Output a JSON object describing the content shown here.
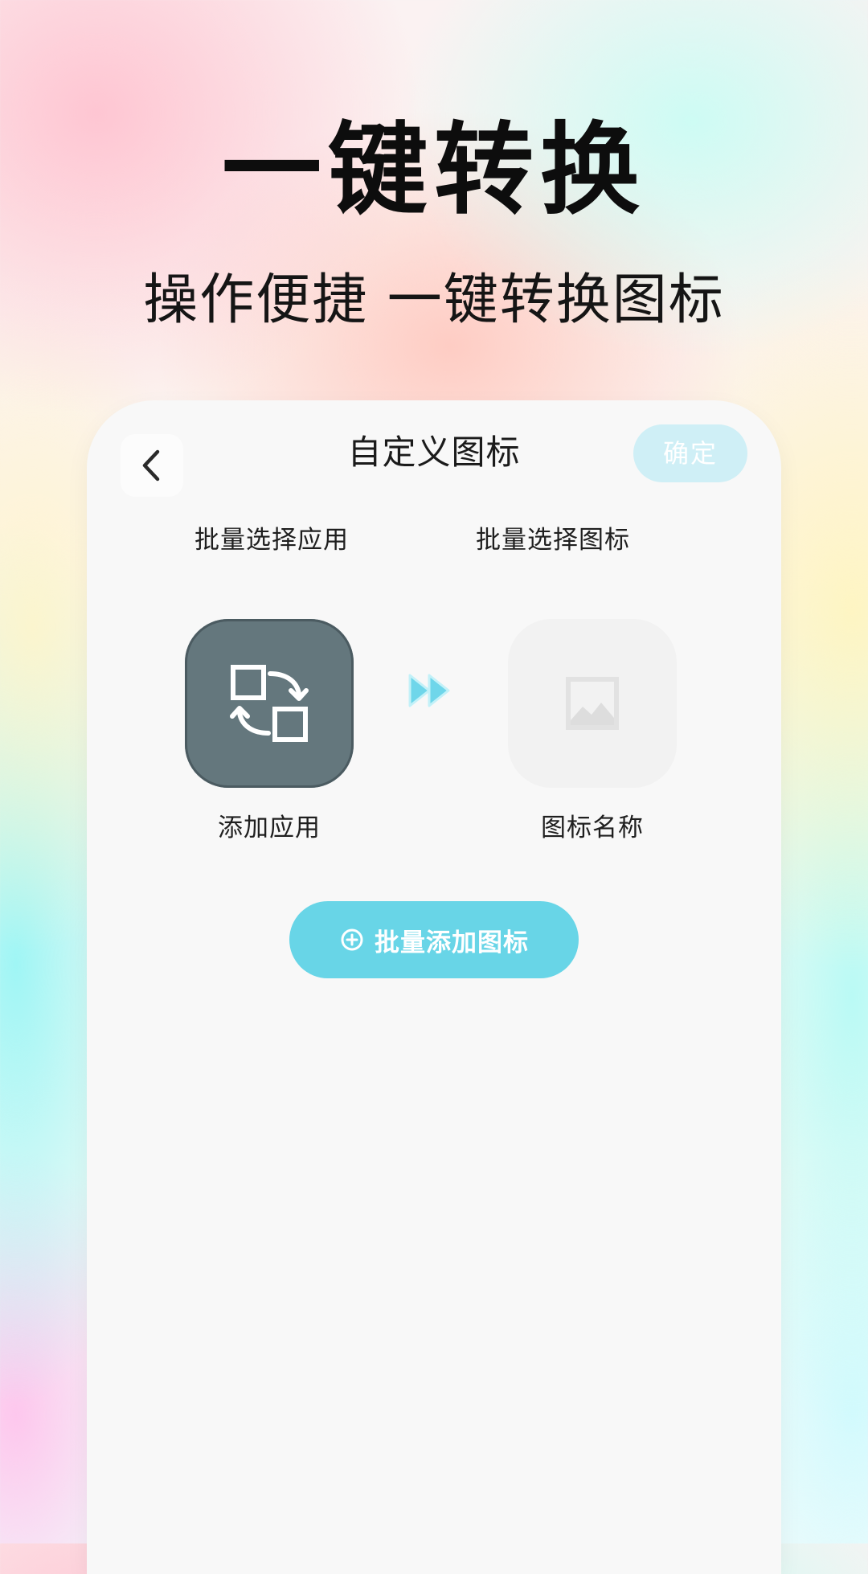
{
  "promo": {
    "headline": "一键转换",
    "subheadline": "操作便捷 一键转换图标"
  },
  "screen": {
    "title": "自定义图标",
    "confirm_label": "确定",
    "columns": {
      "left_label": "批量选择应用",
      "right_label": "批量选择图标"
    },
    "tiles": {
      "left_label": "添加应用",
      "right_label": "图标名称"
    },
    "batch_add_label": "批量添加图标",
    "icons": {
      "back": "chevron-left-icon",
      "app_tile": "swap-icon",
      "arrow": "double-arrow-icon",
      "placeholder": "image-placeholder-icon",
      "batch_add": "plus-circle-icon"
    },
    "colors": {
      "accent": "#68d5e7",
      "confirm_disabled": "#cfeff6",
      "app_tile": "#64777d",
      "placeholder_tile": "#f2f2f2"
    }
  }
}
